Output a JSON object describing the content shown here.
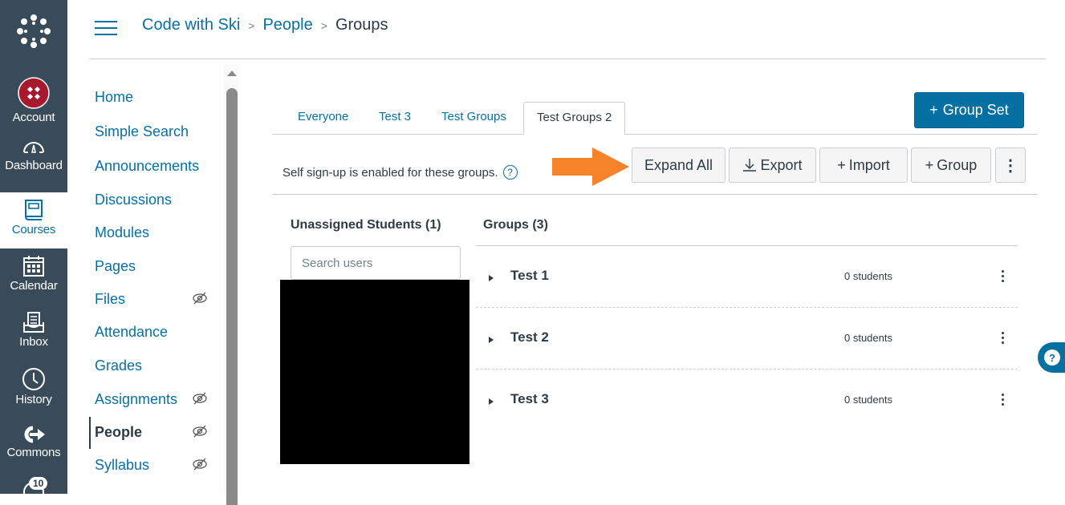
{
  "global_nav": {
    "items": [
      {
        "label": "Account",
        "icon": "account-avatar-icon"
      },
      {
        "label": "Dashboard",
        "icon": "dashboard-icon"
      },
      {
        "label": "Courses",
        "icon": "courses-icon",
        "active": true
      },
      {
        "label": "Calendar",
        "icon": "calendar-icon"
      },
      {
        "label": "Inbox",
        "icon": "inbox-icon"
      },
      {
        "label": "History",
        "icon": "history-icon"
      },
      {
        "label": "Commons",
        "icon": "commons-icon"
      }
    ],
    "help_badge": "10"
  },
  "breadcrumb": {
    "course": "Code with Ski",
    "section": "People",
    "current": "Groups",
    "separator": ">"
  },
  "course_nav": {
    "items": [
      {
        "label": "Home",
        "hidden": false
      },
      {
        "label": "Simple Search",
        "hidden": false
      },
      {
        "label": "Announcements",
        "hidden": false
      },
      {
        "label": "Discussions",
        "hidden": false
      },
      {
        "label": "Modules",
        "hidden": false
      },
      {
        "label": "Pages",
        "hidden": false
      },
      {
        "label": "Files",
        "hidden": true
      },
      {
        "label": "Attendance",
        "hidden": false
      },
      {
        "label": "Grades",
        "hidden": false
      },
      {
        "label": "Assignments",
        "hidden": true
      },
      {
        "label": "People",
        "hidden": true,
        "active": true
      },
      {
        "label": "Syllabus",
        "hidden": true
      }
    ]
  },
  "tabs": [
    {
      "label": "Everyone"
    },
    {
      "label": "Test 3"
    },
    {
      "label": "Test Groups"
    },
    {
      "label": "Test Groups 2",
      "active": true
    }
  ],
  "group_set_button": {
    "icon": "+",
    "label": "Group Set"
  },
  "toolbar": {
    "self_signup_text": "Self sign-up is enabled for these groups.",
    "help_icon": "?",
    "expand_all": "Expand All",
    "export": "Export",
    "import": "Import",
    "add_group": "Group",
    "plus": "+",
    "more": "⋮"
  },
  "unassigned": {
    "heading": "Unassigned Students (1)",
    "search_placeholder": "Search users"
  },
  "groups": {
    "heading": "Groups (3)",
    "items": [
      {
        "name": "Test 1",
        "count": "0 students"
      },
      {
        "name": "Test 2",
        "count": "0 students"
      },
      {
        "name": "Test 3",
        "count": "0 students"
      }
    ]
  },
  "colors": {
    "brand": "#0770a3",
    "nav_bg": "#394b58",
    "annotation_arrow": "#f6822a"
  }
}
